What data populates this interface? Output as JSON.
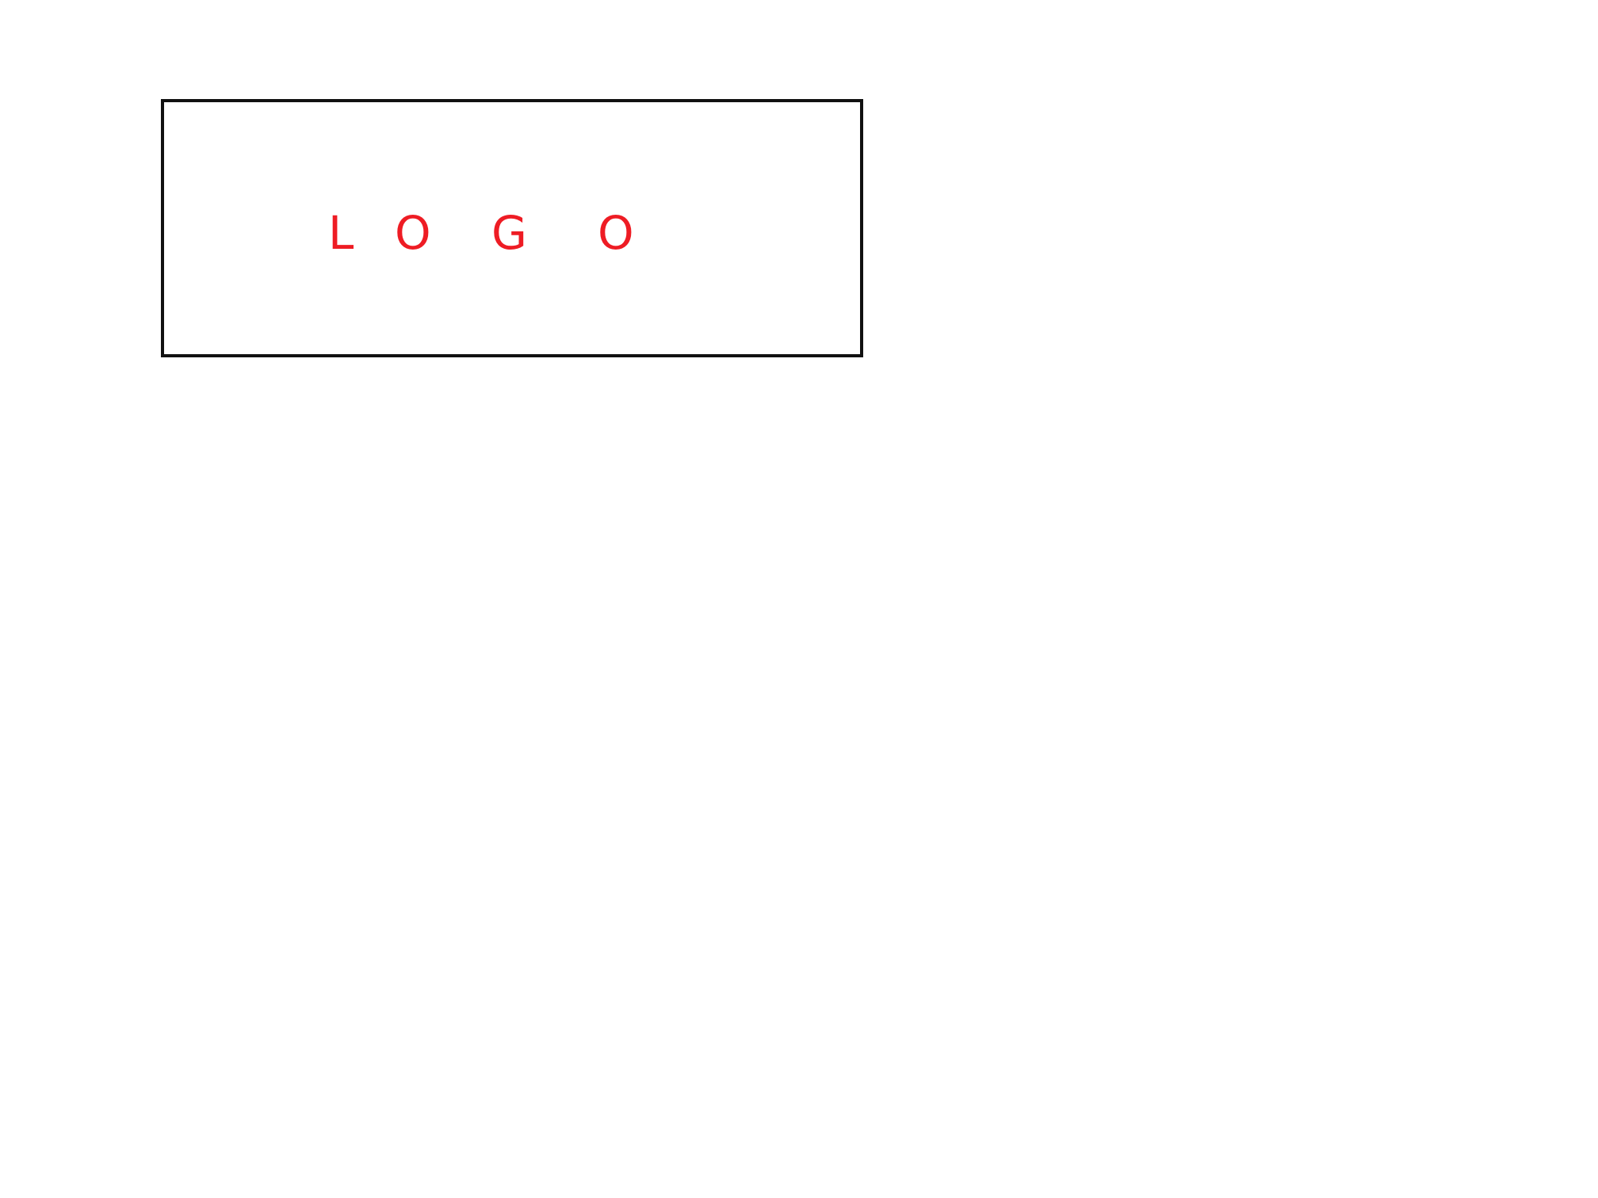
{
  "logo": {
    "letters": [
      "L",
      "O",
      "G",
      "O"
    ],
    "color": "#ee1c24",
    "border_color": "#111111"
  },
  "page": {
    "background": "#ffffff"
  }
}
